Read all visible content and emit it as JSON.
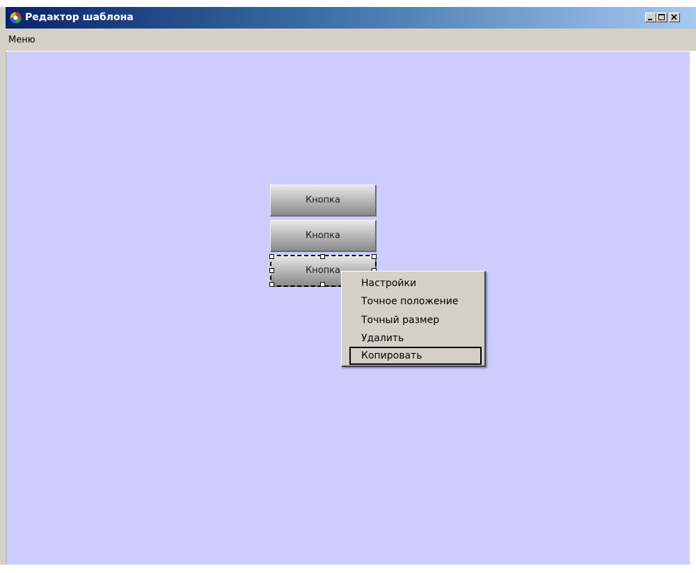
{
  "window": {
    "title": "Редактор шаблона",
    "caption_buttons": [
      "minimize-icon",
      "maximize-icon",
      "close-icon"
    ]
  },
  "menubar": {
    "items": [
      {
        "label": "Меню"
      }
    ]
  },
  "canvas": {
    "background": "#ccccff",
    "buttons": [
      {
        "label": "Кнопка",
        "selected": false
      },
      {
        "label": "Кнопка",
        "selected": false
      },
      {
        "label": "Кнопка",
        "selected": true
      }
    ]
  },
  "context_menu": {
    "items": [
      {
        "label": "Настройки",
        "focused": false
      },
      {
        "label": "Точное положение",
        "focused": false
      },
      {
        "label": "Точный размер",
        "focused": false
      },
      {
        "label": "Удалить",
        "focused": false
      },
      {
        "label": "Копировать",
        "focused": true
      }
    ]
  }
}
